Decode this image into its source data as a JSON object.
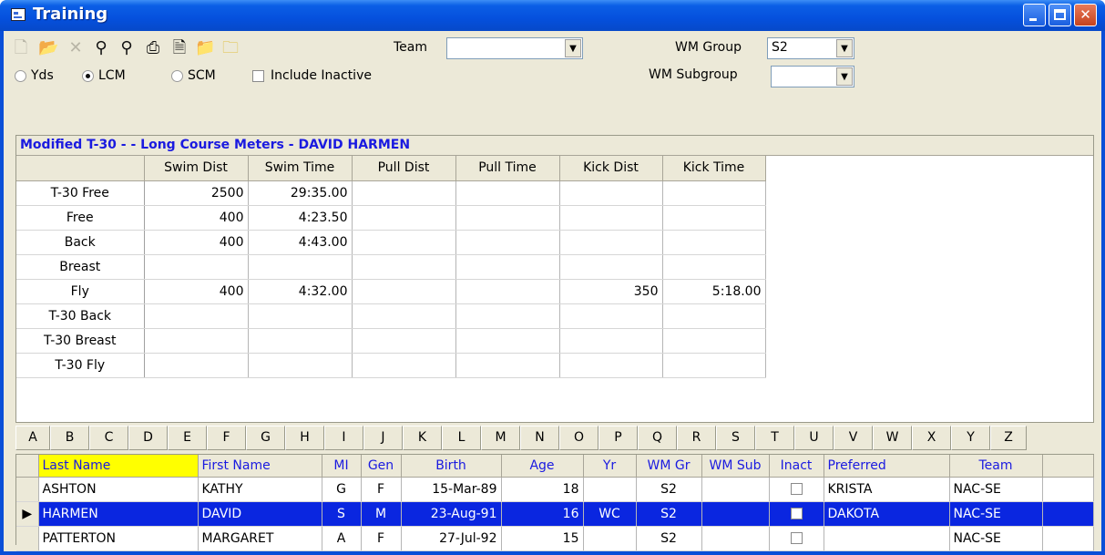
{
  "window": {
    "title": "Training"
  },
  "toolbar": {
    "team_label": "Team",
    "team_value": "",
    "wm_group_label": "WM Group",
    "wm_group_value": "S2",
    "wm_subgroup_label": "WM Subgroup",
    "wm_subgroup_value": "",
    "course_options": [
      {
        "label": "Yds",
        "selected": false
      },
      {
        "label": "LCM",
        "selected": true
      },
      {
        "label": "SCM",
        "selected": false
      }
    ],
    "include_inactive_label": "Include Inactive",
    "include_inactive_checked": false,
    "icons": [
      "new-icon",
      "open-icon",
      "delete-icon",
      "find-icon",
      "find-next-icon",
      "print-icon",
      "print-preview-icon",
      "folder-icon",
      "folder-up-icon"
    ]
  },
  "training_grid": {
    "title": "Modified T-30 -  - Long Course Meters - DAVID HARMEN",
    "columns": [
      "",
      "Swim Dist",
      "Swim Time",
      "Pull Dist",
      "Pull Time",
      "Kick Dist",
      "Kick Time"
    ],
    "rows": [
      {
        "label": "T-30 Free",
        "swim_dist": "2500",
        "swim_time": "29:35.00",
        "pull_dist": "",
        "pull_time": "",
        "kick_dist": "",
        "kick_time": ""
      },
      {
        "label": "Free",
        "swim_dist": "400",
        "swim_time": "4:23.50",
        "pull_dist": "",
        "pull_time": "",
        "kick_dist": "",
        "kick_time": ""
      },
      {
        "label": "Back",
        "swim_dist": "400",
        "swim_time": "4:43.00",
        "pull_dist": "",
        "pull_time": "",
        "kick_dist": "",
        "kick_time": ""
      },
      {
        "label": "Breast",
        "swim_dist": "",
        "swim_time": "",
        "pull_dist": "",
        "pull_time": "",
        "kick_dist": "",
        "kick_time": ""
      },
      {
        "label": "Fly",
        "swim_dist": "400",
        "swim_time": "4:32.00",
        "pull_dist": "",
        "pull_time": "",
        "kick_dist": "350",
        "kick_time": "5:18.00"
      },
      {
        "label": "T-30 Back",
        "swim_dist": "",
        "swim_time": "",
        "pull_dist": "",
        "pull_time": "",
        "kick_dist": "",
        "kick_time": ""
      },
      {
        "label": "T-30 Breast",
        "swim_dist": "",
        "swim_time": "",
        "pull_dist": "",
        "pull_time": "",
        "kick_dist": "",
        "kick_time": ""
      },
      {
        "label": "T-30 Fly",
        "swim_dist": "",
        "swim_time": "",
        "pull_dist": "",
        "pull_time": "",
        "kick_dist": "",
        "kick_time": ""
      }
    ]
  },
  "alphabet": [
    "A",
    "B",
    "C",
    "D",
    "E",
    "F",
    "G",
    "H",
    "I",
    "J",
    "K",
    "L",
    "M",
    "N",
    "O",
    "P",
    "Q",
    "R",
    "S",
    "T",
    "U",
    "V",
    "W",
    "X",
    "Y",
    "Z"
  ],
  "athletes": {
    "columns": [
      "Last Name",
      "First Name",
      "MI",
      "Gen",
      "Birth",
      "Age",
      "Yr",
      "WM Gr",
      "WM Sub",
      "Inact",
      "Preferred",
      "Team"
    ],
    "rows": [
      {
        "last": "ASHTON",
        "first": "KATHY",
        "mi": "G",
        "gen": "F",
        "birth": "15-Mar-89",
        "age": "18",
        "yr": "",
        "wm_gr": "S2",
        "wm_sub": "",
        "inact": false,
        "preferred": "KRISTA",
        "team": "NAC-SE",
        "selected": false
      },
      {
        "last": "HARMEN",
        "first": "DAVID",
        "mi": "S",
        "gen": "M",
        "birth": "23-Aug-91",
        "age": "16",
        "yr": "WC",
        "wm_gr": "S2",
        "wm_sub": "",
        "inact": false,
        "preferred": "DAKOTA",
        "team": "NAC-SE",
        "selected": true
      },
      {
        "last": "PATTERTON",
        "first": "MARGARET",
        "mi": "A",
        "gen": "F",
        "birth": "27-Jul-92",
        "age": "15",
        "yr": "",
        "wm_gr": "S2",
        "wm_sub": "",
        "inact": false,
        "preferred": "",
        "team": "NAC-SE",
        "selected": false
      }
    ]
  }
}
